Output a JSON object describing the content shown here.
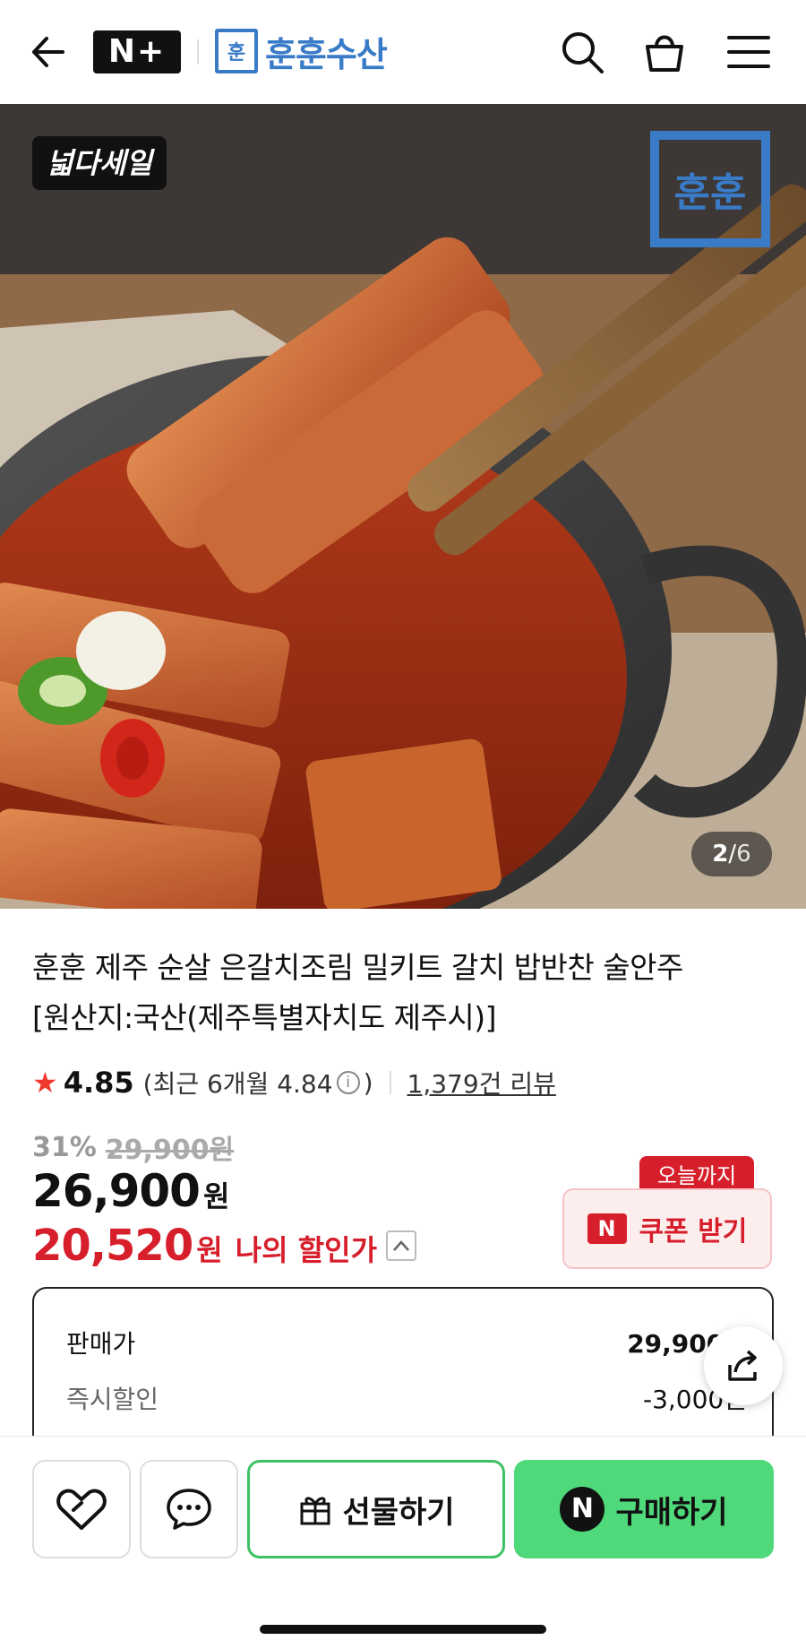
{
  "header": {
    "nplus_logo": "N+",
    "store_logo_text": "훈",
    "store_name": "훈훈수산"
  },
  "hero": {
    "sale_badge": "넓다세일",
    "brand_stamp": "훈훈",
    "counter_current": "2",
    "counter_sep": "/",
    "counter_total": "6"
  },
  "product": {
    "title_line1": "훈훈 제주 순살 은갈치조림 밀키트 갈치 밥반찬 술안주",
    "title_line2": "[원산지:국산(제주특별자치도 제주시)]",
    "star": "★",
    "rating": "4.85",
    "recent_prefix": "(최근 6개월 4.84",
    "info_glyph": "i",
    "recent_suffix": ")",
    "reviews": "1,379건 리뷰",
    "discount_pct": "31%",
    "original_price": "29,900원",
    "price": "26,900",
    "won": "원",
    "my_price": "20,520",
    "my_won": "원",
    "my_price_label": "나의 할인가"
  },
  "coupon": {
    "tag": "오늘까지",
    "n_mark": "N",
    "label": "쿠폰 받기"
  },
  "price_box": {
    "row1_label": "판매가",
    "row1_value": "29,900원",
    "row2_label": "즉시할인",
    "row2_value": "-3,000원"
  },
  "bottom": {
    "gift_label": "선물하기",
    "buy_n": "N",
    "buy_label": "구매하기"
  },
  "colors": {
    "brand_blue": "#3a7bc8",
    "sale_red": "#d71e2b",
    "buy_green": "#4fd97a"
  }
}
